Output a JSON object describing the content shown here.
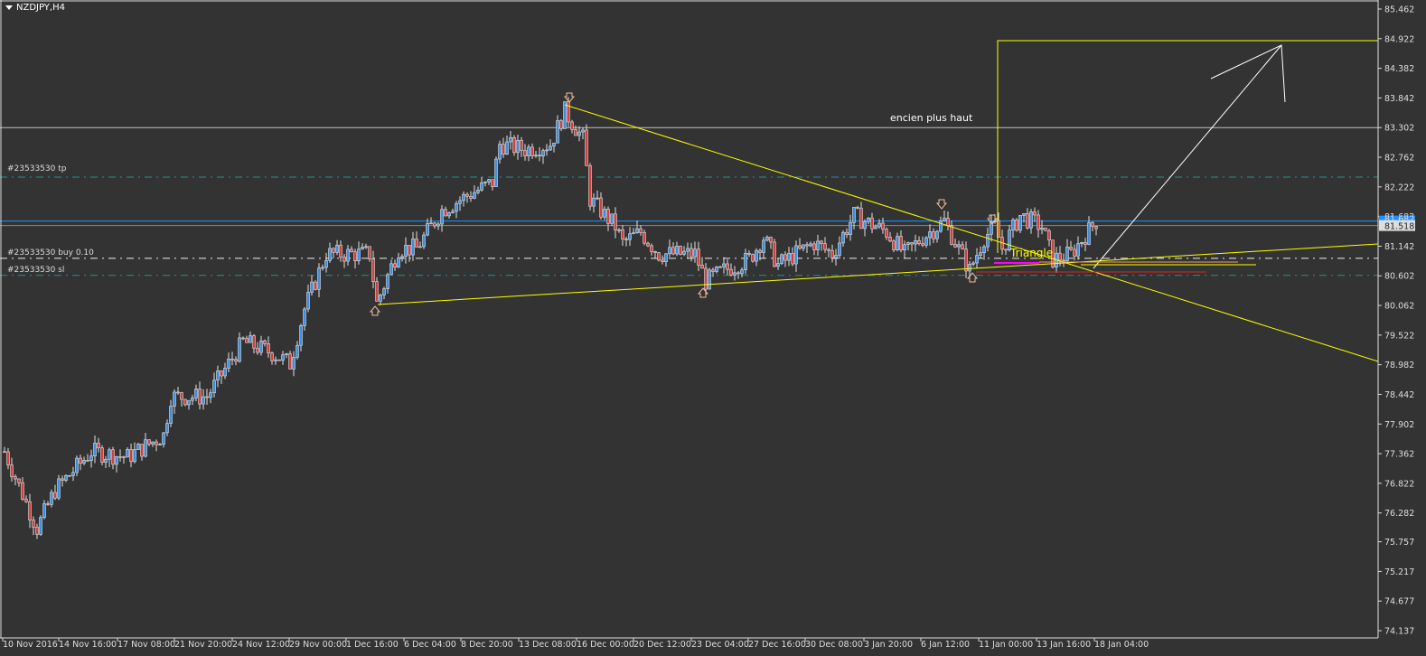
{
  "symbol": "NZDJPY,H4",
  "chart_data": {
    "type": "candlestick",
    "title": "NZDJPY,H4",
    "ylim": [
      74.137,
      85.462
    ],
    "y_ticks": [
      "85.462",
      "84.922",
      "84.382",
      "83.842",
      "83.302",
      "82.762",
      "82.222",
      "81.682",
      "81.142",
      "80.602",
      "80.062",
      "79.522",
      "78.982",
      "78.442",
      "77.902",
      "77.362",
      "76.822",
      "76.282",
      "75.757",
      "75.217",
      "74.677",
      "74.137"
    ],
    "x_ticks": [
      "10 Nov 2016",
      "14 Nov 16:00",
      "17 Nov 08:00",
      "21 Nov 20:00",
      "24 Nov 12:00",
      "29 Nov 00:00",
      "1 Dec 16:00",
      "6 Dec 04:00",
      "8 Dec 20:00",
      "13 Dec 08:00",
      "16 Dec 00:00",
      "20 Dec 12:00",
      "23 Dec 04:00",
      "27 Dec 16:00",
      "30 Dec 08:00",
      "3 Jan 20:00",
      "6 Jan 12:00",
      "11 Jan 00:00",
      "13 Jan 16:00",
      "18 Jan 04:00"
    ],
    "price_path_bar_price": [
      [
        0,
        77.4
      ],
      [
        9,
        76.0
      ],
      [
        14,
        76.7
      ],
      [
        24,
        77.4
      ],
      [
        34,
        77.3
      ],
      [
        44,
        77.7
      ],
      [
        46,
        78.4
      ],
      [
        56,
        78.4
      ],
      [
        66,
        79.4
      ],
      [
        74,
        79.2
      ],
      [
        79,
        79.0
      ],
      [
        83,
        80.0
      ],
      [
        89,
        81.0
      ],
      [
        101,
        81.0
      ],
      [
        103,
        80.1
      ],
      [
        109,
        81.1
      ],
      [
        114,
        81.1
      ],
      [
        121,
        81.8
      ],
      [
        129,
        82.1
      ],
      [
        135,
        82.3
      ],
      [
        137,
        83.0
      ],
      [
        144,
        82.9
      ],
      [
        151,
        83.0
      ],
      [
        155,
        83.6
      ],
      [
        160,
        83.1
      ],
      [
        162,
        82.0
      ],
      [
        169,
        81.5
      ],
      [
        171,
        81.2
      ],
      [
        176,
        81.4
      ],
      [
        181,
        81.0
      ],
      [
        191,
        81.0
      ],
      [
        194,
        80.5
      ],
      [
        199,
        80.7
      ],
      [
        206,
        80.9
      ],
      [
        210,
        81.3
      ],
      [
        214,
        80.8
      ],
      [
        224,
        81.2
      ],
      [
        229,
        81.0
      ],
      [
        235,
        81.7
      ],
      [
        244,
        81.4
      ],
      [
        249,
        81.0
      ],
      [
        254,
        81.3
      ],
      [
        260,
        81.6
      ],
      [
        267,
        80.7
      ],
      [
        271,
        81.3
      ],
      [
        274,
        81.5
      ],
      [
        276,
        81.1
      ],
      [
        281,
        81.7
      ],
      [
        287,
        81.5
      ],
      [
        290,
        80.9
      ],
      [
        295,
        81.0
      ],
      [
        302,
        81.6
      ]
    ],
    "current_bid": "81.518",
    "ask_label": "81.682",
    "levels": {
      "old_high": 83.302,
      "tp": 82.4,
      "ask_line": 81.6,
      "bid": 81.518,
      "buy": 80.92,
      "sl": 80.61
    }
  },
  "orders": {
    "tp_label": "#23533530 tp",
    "buy_label": "#23533530 buy 0.10",
    "sl_label": "#23533530 sl"
  },
  "annotations": {
    "old_high_text": "encien plus haut",
    "triangle_text": "Triangle"
  },
  "colors": {
    "bg": "#333333",
    "bull": "#3d8ee0",
    "bear": "#d04040",
    "wick": "#e0e0e0",
    "trend": "#ffff00",
    "tp_sl": "#2a8f8f",
    "ask": "#1e90ff"
  }
}
